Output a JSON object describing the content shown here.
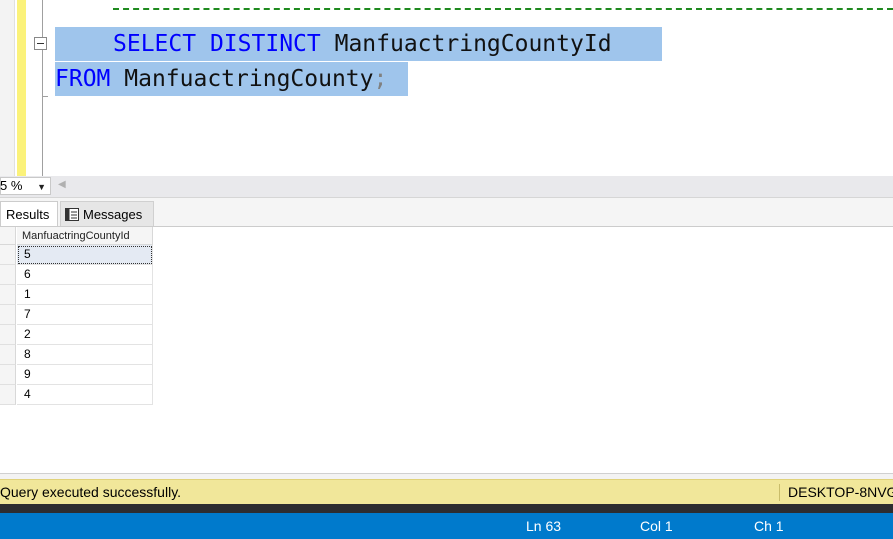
{
  "editor": {
    "line1": {
      "keyword1": "SELECT",
      "keyword2": "DISTINCT",
      "identifier": "ManfuactringCountyId"
    },
    "line2": {
      "keyword": "FROM",
      "identifier": "ManfuactringCounty",
      "terminator": ";"
    }
  },
  "zoom": {
    "value": "5 %"
  },
  "tabs": [
    {
      "label": "Results"
    },
    {
      "label": "Messages"
    }
  ],
  "grid": {
    "column_header": "ManfuactringCountyId",
    "rows": [
      "5",
      "6",
      "1",
      "7",
      "2",
      "8",
      "9",
      "4"
    ]
  },
  "query_status": {
    "message": "Query executed successfully.",
    "server": "DESKTOP-8NVG"
  },
  "statusbar": {
    "line": "Ln 63",
    "col": "Col 1",
    "ch": "Ch 1"
  },
  "colors": {
    "keyword": "#0000ff",
    "selection": "#9fc5ec",
    "status_bar": "#007acc",
    "query_status_bg": "#f1e79a"
  }
}
